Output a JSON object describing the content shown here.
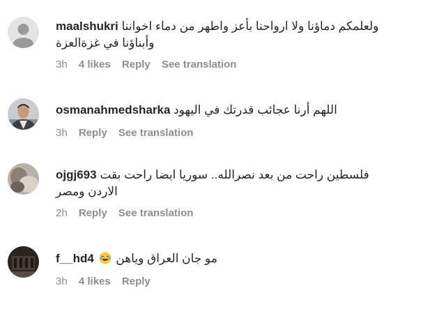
{
  "comments": [
    {
      "username": "maalshukri",
      "text": "ولعلمكم دماؤنا ولا ارواحنا بأعز واطهر من دماء اخواننا",
      "text_cont": "وأبناؤنا في غزةالعزة",
      "time": "3h",
      "likes": "4 likes",
      "reply": "Reply",
      "translate": "See translation",
      "avatar": "default-avatar"
    },
    {
      "username": "osmanahmedsharka",
      "text": "اللهم أرنا عجائب قدرتك في اليهود",
      "time": "3h",
      "reply": "Reply",
      "translate": "See translation",
      "avatar": "photo-man-avatar"
    },
    {
      "username": "ojgj693",
      "text": "فلسطين راحت من بعد نصرالله.. سوريا ايضا راحت بقت",
      "text_cont": "الاردن ومصر",
      "time": "2h",
      "reply": "Reply",
      "translate": "See translation",
      "avatar": "photo-avatar"
    },
    {
      "username": "f__hd4",
      "text": "مو جان العراق وياهن",
      "emoji": "laughing-emoji",
      "time": "3h",
      "likes": "4 likes",
      "reply": "Reply",
      "avatar": "photo-dark-avatar"
    }
  ]
}
